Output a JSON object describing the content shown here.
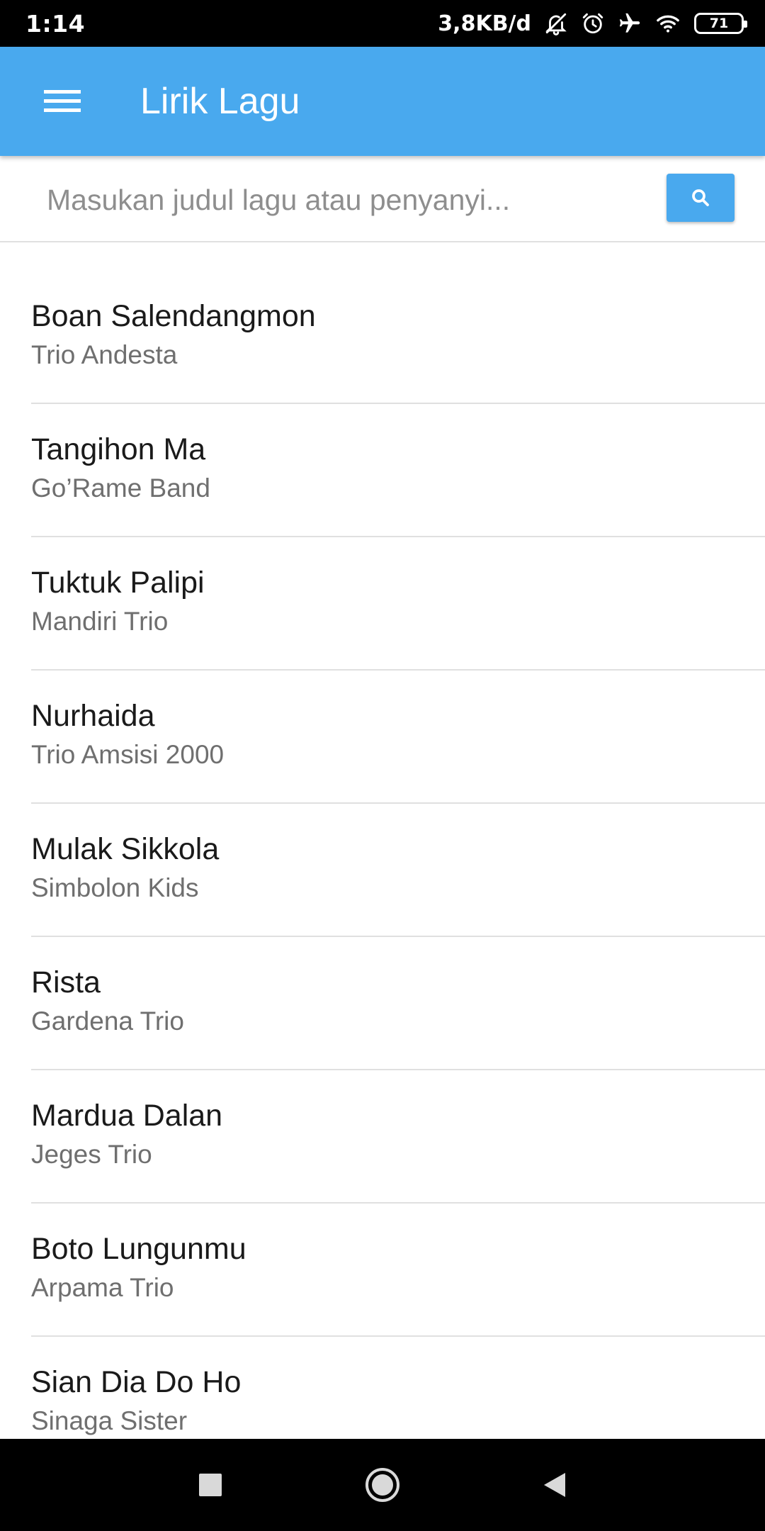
{
  "status_bar": {
    "time": "1:14",
    "net_speed": "3,8KB/d",
    "battery_level": "71",
    "icons": [
      "bell-off-icon",
      "alarm-icon",
      "airplane-icon",
      "wifi-icon",
      "battery-icon"
    ]
  },
  "app_bar": {
    "title": "Lirik Lagu",
    "menu_icon": "menu-icon",
    "color": "#49a9ee"
  },
  "search": {
    "placeholder": "Masukan judul lagu atau penyanyi...",
    "value": "",
    "button_icon": "search-icon"
  },
  "songs": [
    {
      "title": "Boan Salendangmon",
      "artist": "Trio Andesta"
    },
    {
      "title": "Tangihon Ma",
      "artist": "Go’Rame Band"
    },
    {
      "title": "Tuktuk Palipi",
      "artist": "Mandiri Trio"
    },
    {
      "title": "Nurhaida",
      "artist": "Trio Amsisi 2000"
    },
    {
      "title": "Mulak Sikkola",
      "artist": "Simbolon Kids"
    },
    {
      "title": "Rista",
      "artist": "Gardena Trio"
    },
    {
      "title": "Mardua Dalan",
      "artist": "Jeges Trio"
    },
    {
      "title": "Boto Lungunmu",
      "artist": "Arpama Trio"
    },
    {
      "title": "Sian Dia Do Ho",
      "artist": "Sinaga Sister"
    }
  ],
  "nav_bar": {
    "icons": [
      "recents-icon",
      "home-icon",
      "back-icon"
    ]
  }
}
